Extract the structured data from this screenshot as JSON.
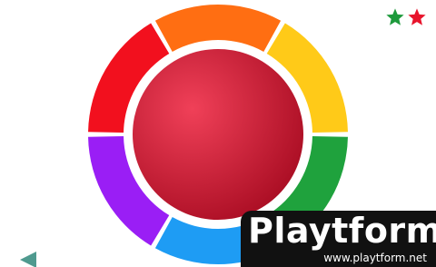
{
  "game": {
    "stars": [
      {
        "icon": "star-icon",
        "color": "#1e9a3c"
      },
      {
        "icon": "star-icon",
        "color": "#e8142c"
      }
    ],
    "back_icon": "left-arrow-icon",
    "wheel_segments": [
      {
        "name": "orange-segment",
        "color": "#ff6e12"
      },
      {
        "name": "yellow-segment",
        "color": "#ffca18"
      },
      {
        "name": "green-segment",
        "color": "#1fa23d"
      },
      {
        "name": "blue-segment",
        "color": "#1e9cf4"
      },
      {
        "name": "purple-segment",
        "color": "#9a1ef5"
      },
      {
        "name": "red-segment",
        "color": "#f2101e"
      }
    ],
    "center_ball": {
      "name": "red-ball",
      "color_light": "#f04058",
      "color_dark": "#a80c22"
    }
  },
  "watermark": {
    "logo": "Playtform",
    "url": "www.playtform.net"
  }
}
